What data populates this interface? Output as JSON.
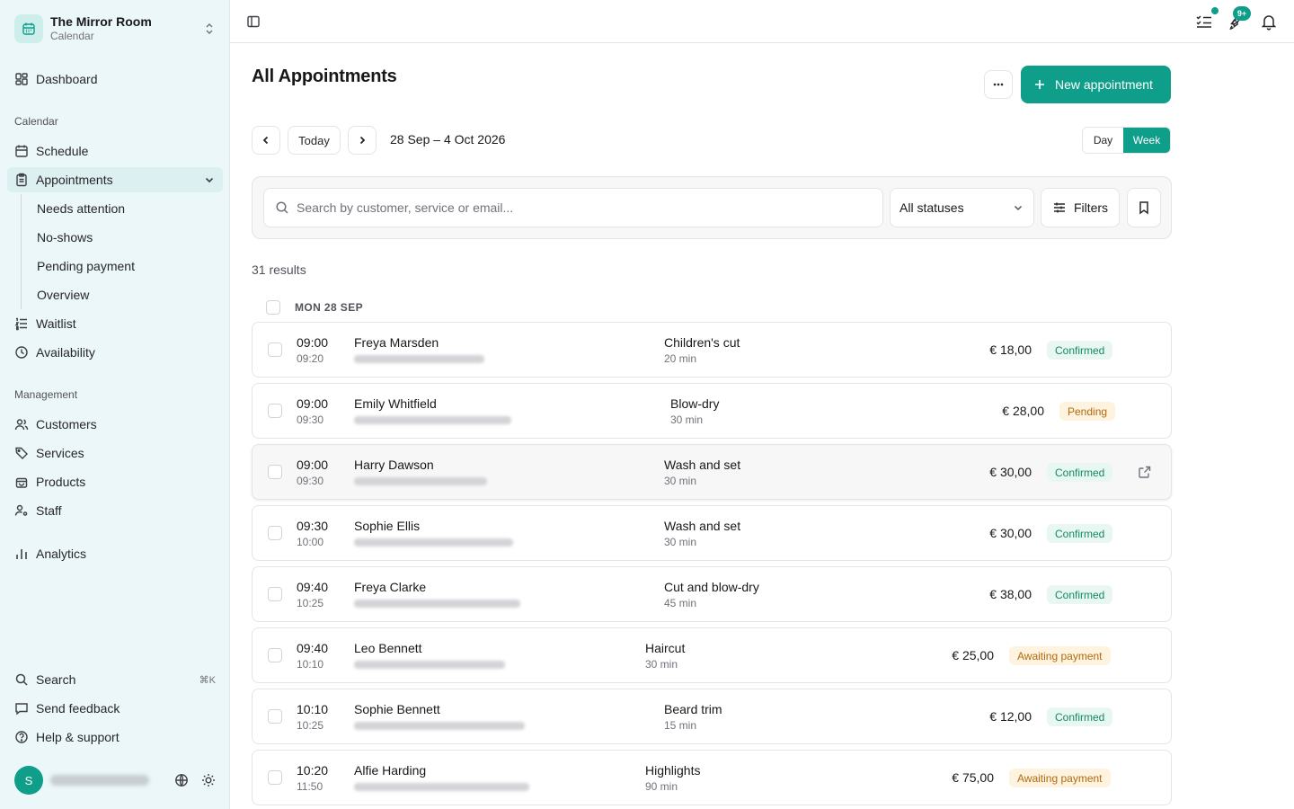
{
  "org": {
    "name": "The Mirror Room",
    "sub": "Calendar"
  },
  "nav": {
    "dashboard": "Dashboard",
    "calendar_label": "Calendar",
    "schedule": "Schedule",
    "appointments": "Appointments",
    "sub_items": [
      "Needs attention",
      "No-shows",
      "Pending payment",
      "Overview"
    ],
    "waitlist": "Waitlist",
    "availability": "Availability",
    "management_label": "Management",
    "customers": "Customers",
    "services": "Services",
    "products": "Products",
    "staff": "Staff",
    "analytics": "Analytics",
    "search": "Search",
    "search_shortcut": "⌘K",
    "feedback": "Send feedback",
    "help": "Help & support"
  },
  "user": {
    "initial": "S"
  },
  "topbar": {
    "notif_badge": "9+"
  },
  "page": {
    "title": "All Appointments",
    "new_button": "New appointment",
    "today": "Today",
    "date_range": "28 Sep – 4 Oct 2026",
    "view_day": "Day",
    "view_week": "Week",
    "search_placeholder": "Search by customer, service or email...",
    "status_select": "All statuses",
    "filters": "Filters",
    "results": "31 results",
    "day_header": "MON 28 SEP"
  },
  "colors": {
    "accent": "#0f9e8a",
    "sidebar_bg": "#ebf7f8",
    "confirmed": "#138a62",
    "pending": "#b4690e"
  },
  "appointments": [
    {
      "start": "09:00",
      "end": "09:20",
      "name": "Freya Marsden",
      "service": "Children's cut",
      "duration": "20 min",
      "price": "€ 18,00",
      "status": "Confirmed",
      "status_type": "confirmed"
    },
    {
      "start": "09:00",
      "end": "09:30",
      "name": "Emily Whitfield",
      "service": "Blow-dry",
      "duration": "30 min",
      "price": "€ 28,00",
      "status": "Pending",
      "status_type": "pending"
    },
    {
      "start": "09:00",
      "end": "09:30",
      "name": "Harry Dawson",
      "service": "Wash and set",
      "duration": "30 min",
      "price": "€ 30,00",
      "status": "Confirmed",
      "status_type": "confirmed"
    },
    {
      "start": "09:30",
      "end": "10:00",
      "name": "Sophie Ellis",
      "service": "Wash and set",
      "duration": "30 min",
      "price": "€ 30,00",
      "status": "Confirmed",
      "status_type": "confirmed"
    },
    {
      "start": "09:40",
      "end": "10:25",
      "name": "Freya Clarke",
      "service": "Cut and blow-dry",
      "duration": "45 min",
      "price": "€ 38,00",
      "status": "Confirmed",
      "status_type": "confirmed"
    },
    {
      "start": "09:40",
      "end": "10:10",
      "name": "Leo Bennett",
      "service": "Haircut",
      "duration": "30 min",
      "price": "€ 25,00",
      "status": "Awaiting payment",
      "status_type": "awaiting"
    },
    {
      "start": "10:10",
      "end": "10:25",
      "name": "Sophie Bennett",
      "service": "Beard trim",
      "duration": "15 min",
      "price": "€ 12,00",
      "status": "Confirmed",
      "status_type": "confirmed"
    },
    {
      "start": "10:20",
      "end": "11:50",
      "name": "Alfie Harding",
      "service": "Highlights",
      "duration": "90 min",
      "price": "€ 75,00",
      "status": "Awaiting payment",
      "status_type": "awaiting"
    }
  ]
}
